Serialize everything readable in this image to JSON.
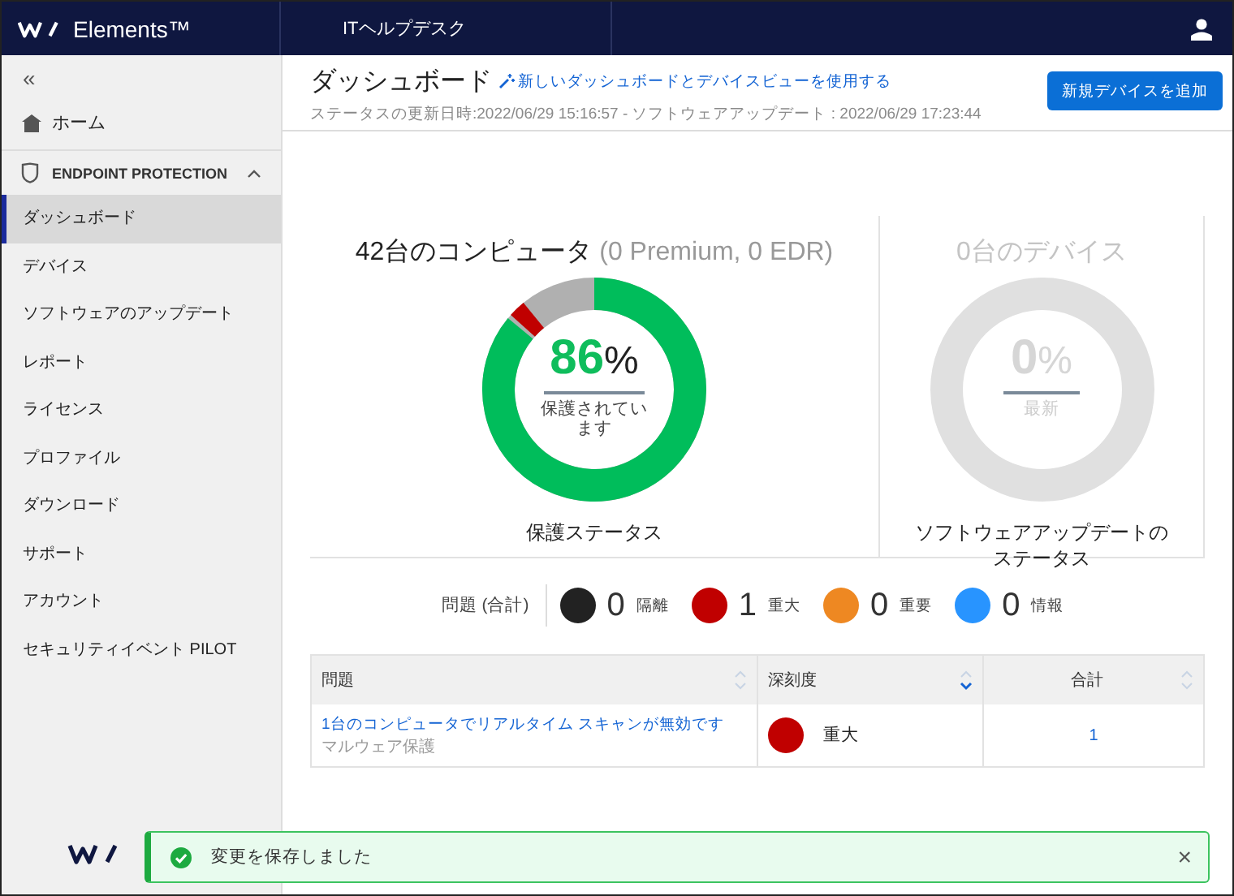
{
  "topbar": {
    "brand": "Elements™",
    "org": "ITヘルプデスク"
  },
  "sidebar": {
    "collapse": "«",
    "home": "ホーム",
    "section": {
      "title": "ENDPOINT PROTECTION",
      "expanded": true
    },
    "items": [
      {
        "label": "ダッシュボード",
        "selected": true
      },
      {
        "label": "デバイス",
        "selected": false
      },
      {
        "label": "ソフトウェアのアップデート",
        "selected": false
      },
      {
        "label": "レポート",
        "selected": false
      },
      {
        "label": "ライセンス",
        "selected": false
      },
      {
        "label": "プロファイル",
        "selected": false
      },
      {
        "label": "ダウンロード",
        "selected": false
      },
      {
        "label": "サポート",
        "selected": false
      },
      {
        "label": "アカウント",
        "selected": false
      },
      {
        "label": "セキュリティイベント PILOT",
        "selected": false
      }
    ]
  },
  "header": {
    "title": "ダッシュボード",
    "link": "新しいダッシュボードとデバイスビューを使用する",
    "subtitle": "ステータスの更新日時:2022/06/29 15:16:57 - ソフトウェアアップデート : 2022/06/29 17:23:44",
    "button": "新規デバイスを追加"
  },
  "gauges": [
    {
      "title": "42台のコンピュータ",
      "subtitle": "(0 Premium, 0 EDR)",
      "value": "86",
      "unit": "%",
      "caption": "保護されています",
      "label": "保護ステータス",
      "disabled": false
    },
    {
      "title": "0台のデバイス",
      "value": "0",
      "unit": "%",
      "caption": "最新",
      "label": "ソフトウェアアップデートのステータス",
      "disabled": true
    }
  ],
  "issues": {
    "label": "問題 (合計)",
    "items": [
      {
        "count": "0",
        "label": "隔離",
        "color": "#222222"
      },
      {
        "count": "1",
        "label": "重大",
        "color": "#c00000"
      },
      {
        "count": "0",
        "label": "重要",
        "color": "#ee8822"
      },
      {
        "count": "0",
        "label": "情報",
        "color": "#2894ff"
      }
    ]
  },
  "table": {
    "columns": [
      {
        "label": "問題",
        "sorted": false
      },
      {
        "label": "深刻度",
        "sorted": true
      },
      {
        "label": "合計",
        "sorted": false
      }
    ],
    "rows": [
      {
        "issue": "1台のコンピュータでリアルタイム スキャンが無効です",
        "category": "マルウェア保護",
        "severity": "重大",
        "color": "#c00000",
        "total": "1"
      }
    ]
  },
  "toast": {
    "message": "変更を保存しました",
    "close": "×"
  }
}
